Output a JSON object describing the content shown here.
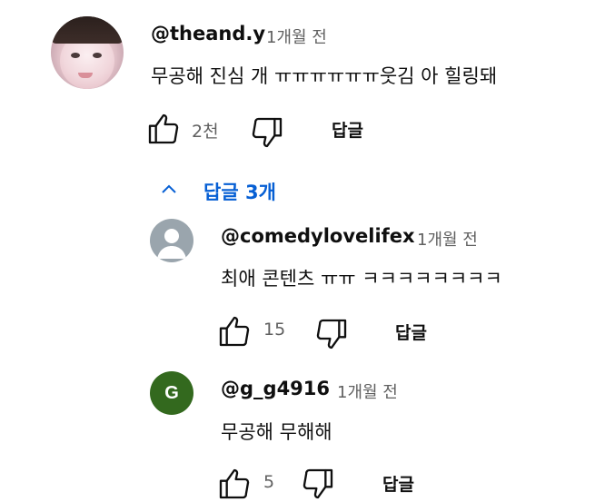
{
  "thread": {
    "main": {
      "author": "@theand.y",
      "time": "1개월 전",
      "text": "무공해 진심 개 ㅠㅠㅠㅠㅠㅠ웃김 아 힐링돼",
      "likes": "2천",
      "reply_label": "답글"
    },
    "replies_toggle": "답글 3개",
    "replies": [
      {
        "author": "@comedylovelifex",
        "time": "1개월 전",
        "text": "최애 콘텐츠 ㅠㅠ ㅋㅋㅋㅋㅋㅋㅋㅋ",
        "likes": "15",
        "reply_label": "답글"
      },
      {
        "author": "@g_g4916",
        "time": "1개월 전",
        "text": "무공해 무해해",
        "avatar_letter": "G",
        "likes": "5",
        "reply_label": "답글"
      }
    ]
  },
  "colors": {
    "link": "#065fd4",
    "secondary_text": "#606060",
    "green_avatar": "#33691e",
    "gray_avatar": "#9aa5ad"
  },
  "icons": [
    "thumb-up-icon",
    "thumb-down-icon",
    "chevron-up-icon",
    "default-avatar-icon"
  ]
}
